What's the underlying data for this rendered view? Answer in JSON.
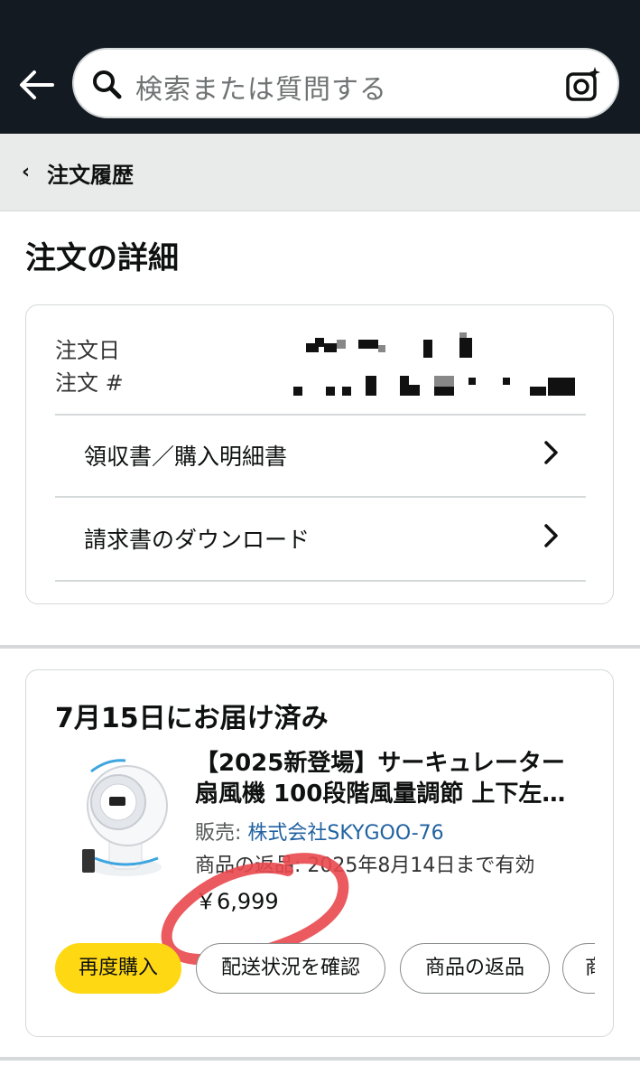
{
  "search": {
    "placeholder": "検索または質問する"
  },
  "breadcrumb": {
    "label": "注文履歴"
  },
  "page": {
    "title": "注文の詳細"
  },
  "order_meta": {
    "date_label": "注文日",
    "number_label": "注文 #"
  },
  "links": [
    {
      "label": "領収書／購入明細書"
    },
    {
      "label": "請求書のダウンロード"
    }
  ],
  "shipment": {
    "status": "7月15日にお届け済み",
    "product": {
      "title_line1": "【2025新登場】サーキュレーター",
      "title_line2": "扇風機 100段階風量調節 上下左…",
      "seller_prefix": "販売: ",
      "seller_name": "株式会社SKYGOO-76",
      "return_info": "商品の返品: 2025年8月14日まで有効",
      "price": "￥6,999"
    },
    "actions": [
      {
        "label": "再度購入"
      },
      {
        "label": "配送状況を確認"
      },
      {
        "label": "商品の返品"
      },
      {
        "label": "商"
      }
    ]
  },
  "colors": {
    "header_bg": "#131a22",
    "primary_button": "#ffd814",
    "link": "#2162a1",
    "annotation_circle": "#e8484e"
  },
  "icons": [
    "back-arrow-icon",
    "search-icon",
    "camera-icon",
    "chevron-left-icon",
    "chevron-right-icon"
  ]
}
